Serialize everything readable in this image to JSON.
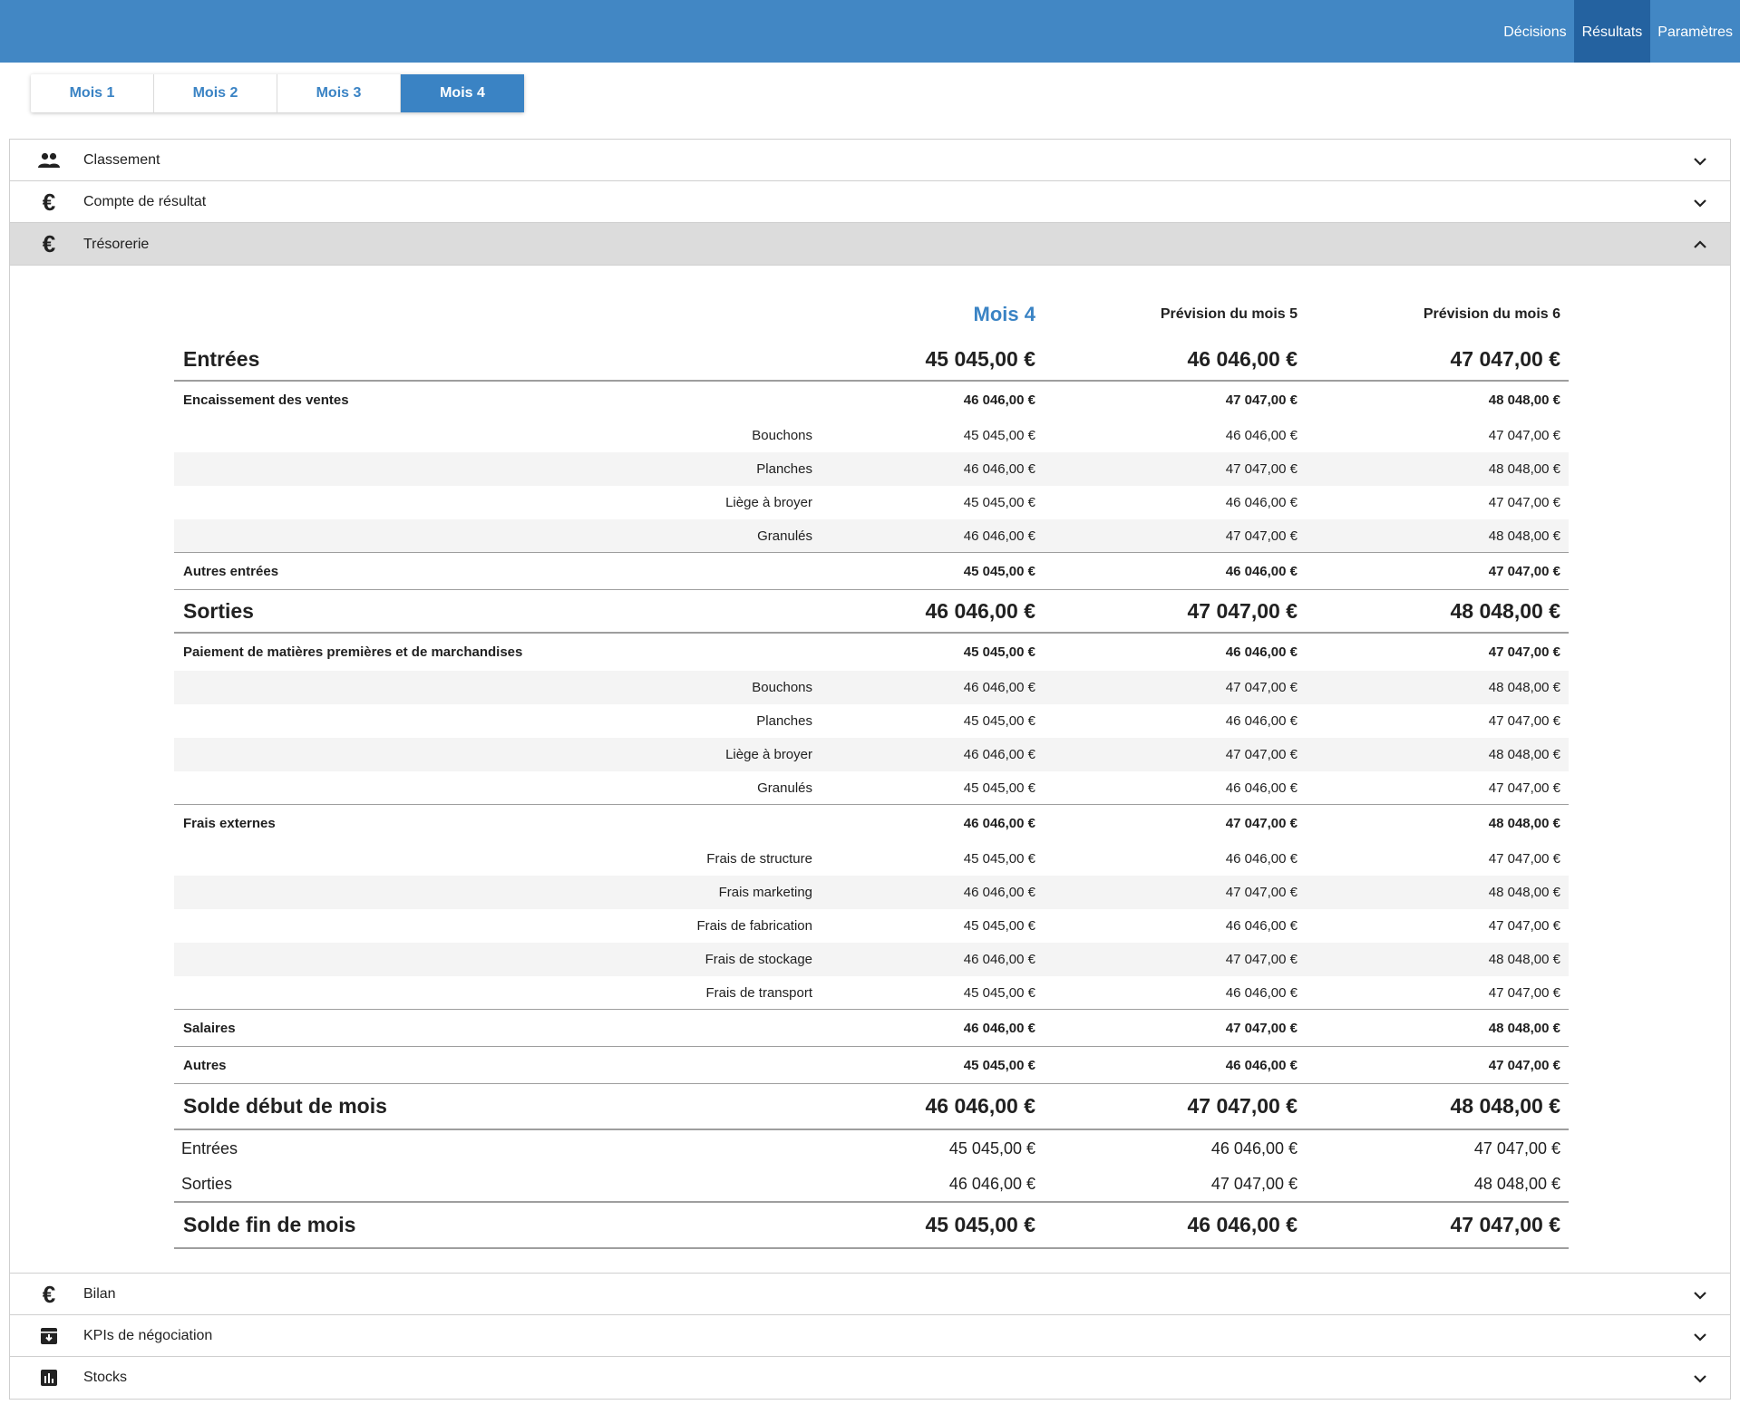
{
  "nav": {
    "items": [
      {
        "label": "Décisions",
        "active": false
      },
      {
        "label": "Résultats",
        "active": true
      },
      {
        "label": "Paramètres",
        "active": false
      }
    ]
  },
  "tabs": [
    {
      "label": "Mois 1",
      "active": false
    },
    {
      "label": "Mois 2",
      "active": false
    },
    {
      "label": "Mois 3",
      "active": false
    },
    {
      "label": "Mois 4",
      "active": true
    }
  ],
  "sections": [
    {
      "title": "Classement",
      "icon": "people-icon",
      "open": false
    },
    {
      "title": "Compte de résultat",
      "icon": "euro-icon",
      "open": false
    },
    {
      "title": "Trésorerie",
      "icon": "euro-icon",
      "open": true
    },
    {
      "title": "Bilan",
      "icon": "euro-icon",
      "open": false
    },
    {
      "title": "KPIs de négociation",
      "icon": "archive-icon",
      "open": false
    },
    {
      "title": "Stocks",
      "icon": "bar-chart-icon",
      "open": false
    }
  ],
  "colors": {
    "topbar": "#4287c4",
    "nav_active": "#2462a0",
    "accent": "#3a83c4",
    "open_header": "#dcdcdc"
  },
  "tresorerie": {
    "columns": [
      "Mois 4",
      "Prévision du mois 5",
      "Prévision du mois 6"
    ],
    "entrees": {
      "label": "Entrées",
      "values": [
        "45 045,00 €",
        "46 046,00 €",
        "47 047,00 €"
      ],
      "encaissement": {
        "label": "Encaissement des ventes",
        "values": [
          "46 046,00 €",
          "47 047,00 €",
          "48 048,00 €"
        ],
        "items": [
          {
            "label": "Bouchons",
            "values": [
              "45 045,00 €",
              "46 046,00 €",
              "47 047,00 €"
            ]
          },
          {
            "label": "Planches",
            "values": [
              "46 046,00 €",
              "47 047,00 €",
              "48 048,00 €"
            ]
          },
          {
            "label": "Liège à broyer",
            "values": [
              "45 045,00 €",
              "46 046,00 €",
              "47 047,00 €"
            ]
          },
          {
            "label": "Granulés",
            "values": [
              "46 046,00 €",
              "47 047,00 €",
              "48 048,00 €"
            ]
          }
        ]
      },
      "autres": {
        "label": "Autres entrées",
        "values": [
          "45 045,00 €",
          "46 046,00 €",
          "47 047,00 €"
        ]
      }
    },
    "sorties": {
      "label": "Sorties",
      "values": [
        "46 046,00 €",
        "47 047,00 €",
        "48 048,00 €"
      ],
      "paiement": {
        "label": "Paiement de matières premières et de marchandises",
        "values": [
          "45 045,00 €",
          "46 046,00 €",
          "47 047,00 €"
        ],
        "items": [
          {
            "label": "Bouchons",
            "values": [
              "46 046,00 €",
              "47 047,00 €",
              "48 048,00 €"
            ]
          },
          {
            "label": "Planches",
            "values": [
              "45 045,00 €",
              "46 046,00 €",
              "47 047,00 €"
            ]
          },
          {
            "label": "Liège à broyer",
            "values": [
              "46 046,00 €",
              "47 047,00 €",
              "48 048,00 €"
            ]
          },
          {
            "label": "Granulés",
            "values": [
              "45 045,00 €",
              "46 046,00 €",
              "47 047,00 €"
            ]
          }
        ]
      },
      "frais": {
        "label": "Frais externes",
        "values": [
          "46 046,00 €",
          "47 047,00 €",
          "48 048,00 €"
        ],
        "items": [
          {
            "label": "Frais de structure",
            "values": [
              "45 045,00 €",
              "46 046,00 €",
              "47 047,00 €"
            ]
          },
          {
            "label": "Frais marketing",
            "values": [
              "46 046,00 €",
              "47 047,00 €",
              "48 048,00 €"
            ]
          },
          {
            "label": "Frais de fabrication",
            "values": [
              "45 045,00 €",
              "46 046,00 €",
              "47 047,00 €"
            ]
          },
          {
            "label": "Frais de stockage",
            "values": [
              "46 046,00 €",
              "47 047,00 €",
              "48 048,00 €"
            ]
          },
          {
            "label": "Frais de transport",
            "values": [
              "45 045,00 €",
              "46 046,00 €",
              "47 047,00 €"
            ]
          }
        ]
      },
      "salaires": {
        "label": "Salaires",
        "values": [
          "46 046,00 €",
          "47 047,00 €",
          "48 048,00 €"
        ]
      },
      "autres": {
        "label": "Autres",
        "values": [
          "45 045,00 €",
          "46 046,00 €",
          "47 047,00 €"
        ]
      }
    },
    "solde_debut": {
      "label": "Solde début de mois",
      "values": [
        "46 046,00 €",
        "47 047,00 €",
        "48 048,00 €"
      ]
    },
    "resume": [
      {
        "label": "Entrées",
        "values": [
          "45 045,00 €",
          "46 046,00 €",
          "47 047,00 €"
        ]
      },
      {
        "label": "Sorties",
        "values": [
          "46 046,00 €",
          "47 047,00 €",
          "48 048,00 €"
        ]
      }
    ],
    "solde_fin": {
      "label": "Solde fin de mois",
      "values": [
        "45 045,00 €",
        "46 046,00 €",
        "47 047,00 €"
      ]
    }
  }
}
